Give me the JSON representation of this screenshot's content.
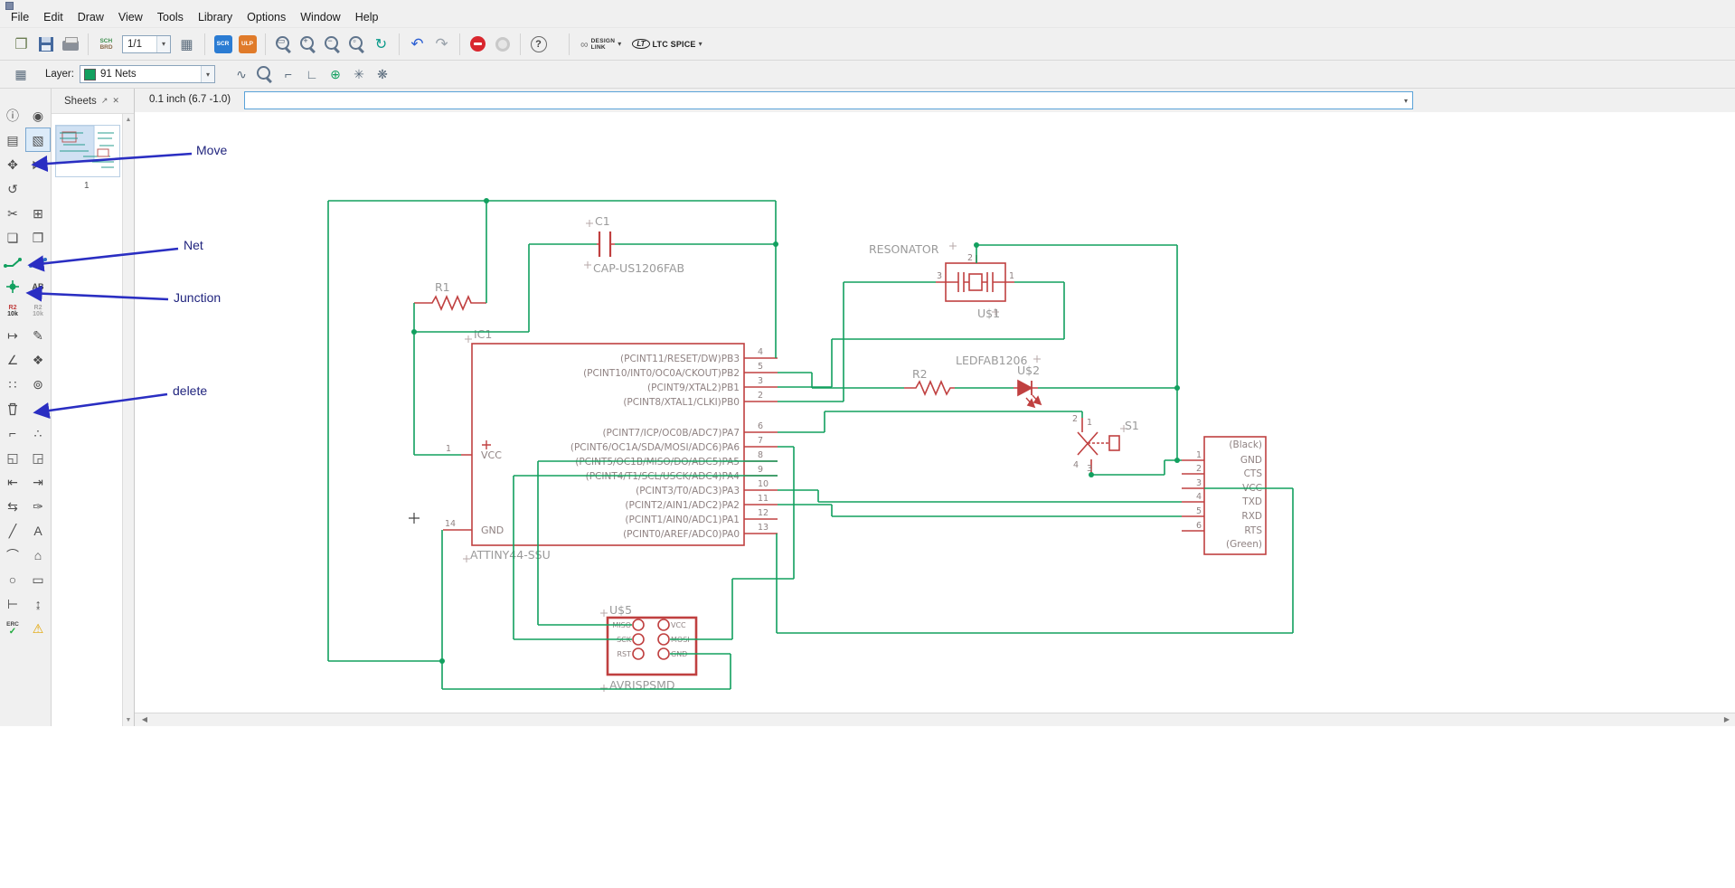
{
  "menu": {
    "items": [
      "File",
      "Edit",
      "Draw",
      "View",
      "Tools",
      "Library",
      "Options",
      "Window",
      "Help"
    ]
  },
  "toolbar": {
    "sheet_combo": "1/1",
    "sch": "SCH",
    "brd": "BRD",
    "scr": "SCR",
    "ulp": "ULP",
    "design_link_1": "DESIGN",
    "design_link_2": "LINK",
    "ltc_logo": "LT",
    "ltc_text": "LTC SPICE",
    "glyphs": {
      "open": "❐",
      "grid": "▦",
      "zoom_fit": "▭",
      "zoom_in": "+",
      "zoom_out": "−",
      "zoom_select": "▫",
      "zoom_redraw": "↻",
      "undo": "↶",
      "redo": "↷",
      "help": "?",
      "link": "∞",
      "caret": "▾"
    }
  },
  "toolbar2": {
    "layer_label": "Layer:",
    "layer_value": "91 Nets",
    "glyphs": {
      "grid": "▦",
      "wave": "∿",
      "bend1": "⌐",
      "bend2": "∟",
      "addnet": "⊕",
      "gear1": "✳",
      "gear2": "❋",
      "caret": "▾"
    }
  },
  "cmdbar": {
    "coordinates": "0.1 inch (6.7 -1.0)",
    "command_value": "",
    "caret": "▾"
  },
  "sheets": {
    "title": "Sheets",
    "popout": "↗",
    "close": "✕",
    "page": "1",
    "up": "▲",
    "down": "▼"
  },
  "scroll": {
    "left": "◀",
    "right": "▶"
  },
  "annotations": {
    "move": "Move",
    "net": "Net",
    "junction": "Junction",
    "delete": "delete"
  },
  "toolbox": {
    "glyphs": {
      "info": "ⓘ",
      "show": "◉",
      "display": "▤",
      "group": "▧",
      "move": "✥",
      "mirror": "⋈",
      "rotate": "↺",
      "cut": "✂",
      "add": "⊞",
      "copy": "❏",
      "paste": "❒",
      "pinswap": "↦",
      "name": "✎",
      "miter": "∠",
      "attribute": "❖",
      "array": "∷",
      "tag": "⊚",
      "ripup": "⌐",
      "select": "∴",
      "sweep": "◱",
      "gateswap": "◲",
      "pan_left": "⇤",
      "pan_right": "⇥",
      "swap": "⇆",
      "replace": "✑",
      "wire": "╱",
      "text": "A",
      "arc": "⌒",
      "polygon": "⌂",
      "circle": "○",
      "rect": "▭",
      "dimension": "⊢",
      "measure": "↨",
      "warning": "⚠"
    },
    "label_ab": "AB",
    "value_ref": "R2",
    "value_val": "10k",
    "erc": "ERC"
  },
  "schematic": {
    "ic1": {
      "ref": "IC1",
      "value": "ATTINY44-SSU",
      "pin1": "1",
      "pin14": "14",
      "vcc": "VCC",
      "gnd": "GND",
      "vcc_plus": "+",
      "pins": [
        {
          "name": "(PCINT11/RESET/DW)PB3",
          "num": "4"
        },
        {
          "name": "(PCINT10/INT0/OC0A/CKOUT)PB2",
          "num": "5"
        },
        {
          "name": "(PCINT9/XTAL2)PB1",
          "num": "3"
        },
        {
          "name": "(PCINT8/XTAL1/CLKI)PB0",
          "num": "2"
        },
        {
          "name": "(PCINT7/ICP/OC0B/ADC7)PA7",
          "num": "6"
        },
        {
          "name": "(PCINT6/OC1A/SDA/MOSI/ADC6)PA6",
          "num": "7"
        },
        {
          "name": "(PCINT5/OC1B/MISO/DO/ADC5)PA5",
          "num": "8"
        },
        {
          "name": "(PCINT4/T1/SCL/USCK/ADC4)PA4",
          "num": "9"
        },
        {
          "name": "(PCINT3/T0/ADC3)PA3",
          "num": "10"
        },
        {
          "name": "(PCINT2/AIN1/ADC2)PA2",
          "num": "11"
        },
        {
          "name": "(PCINT1/AIN0/ADC1)PA1",
          "num": "12"
        },
        {
          "name": "(PCINT0/AREF/ADC0)PA0",
          "num": "13"
        }
      ]
    },
    "c1": {
      "ref": "C1",
      "value": "CAP-US1206FAB"
    },
    "r1": {
      "ref": "R1"
    },
    "r2": {
      "ref": "R2"
    },
    "resonator": {
      "value": "RESONATOR",
      "ref": "U$1",
      "p3": "3",
      "p1": "1",
      "p2": "2"
    },
    "led": {
      "value": "LEDFAB1206",
      "ref": "U$2"
    },
    "s1": {
      "ref": "S1",
      "p1": "1",
      "p2": "2",
      "p3": "3",
      "p4": "4"
    },
    "ftdi": {
      "labels": [
        "(Black)",
        "GND",
        "CTS",
        "VCC",
        "TXD",
        "RXD",
        "RTS",
        "(Green)"
      ],
      "pins": [
        "1",
        "2",
        "3",
        "4",
        "5",
        "6"
      ]
    },
    "avrisp": {
      "ref": "U$5",
      "value": "AVRISPSMD",
      "miso": "MISO",
      "vcc": "VCC",
      "sck": "SCK",
      "mosi": "MOSI",
      "rst": "RST",
      "gnd": "GND"
    }
  }
}
